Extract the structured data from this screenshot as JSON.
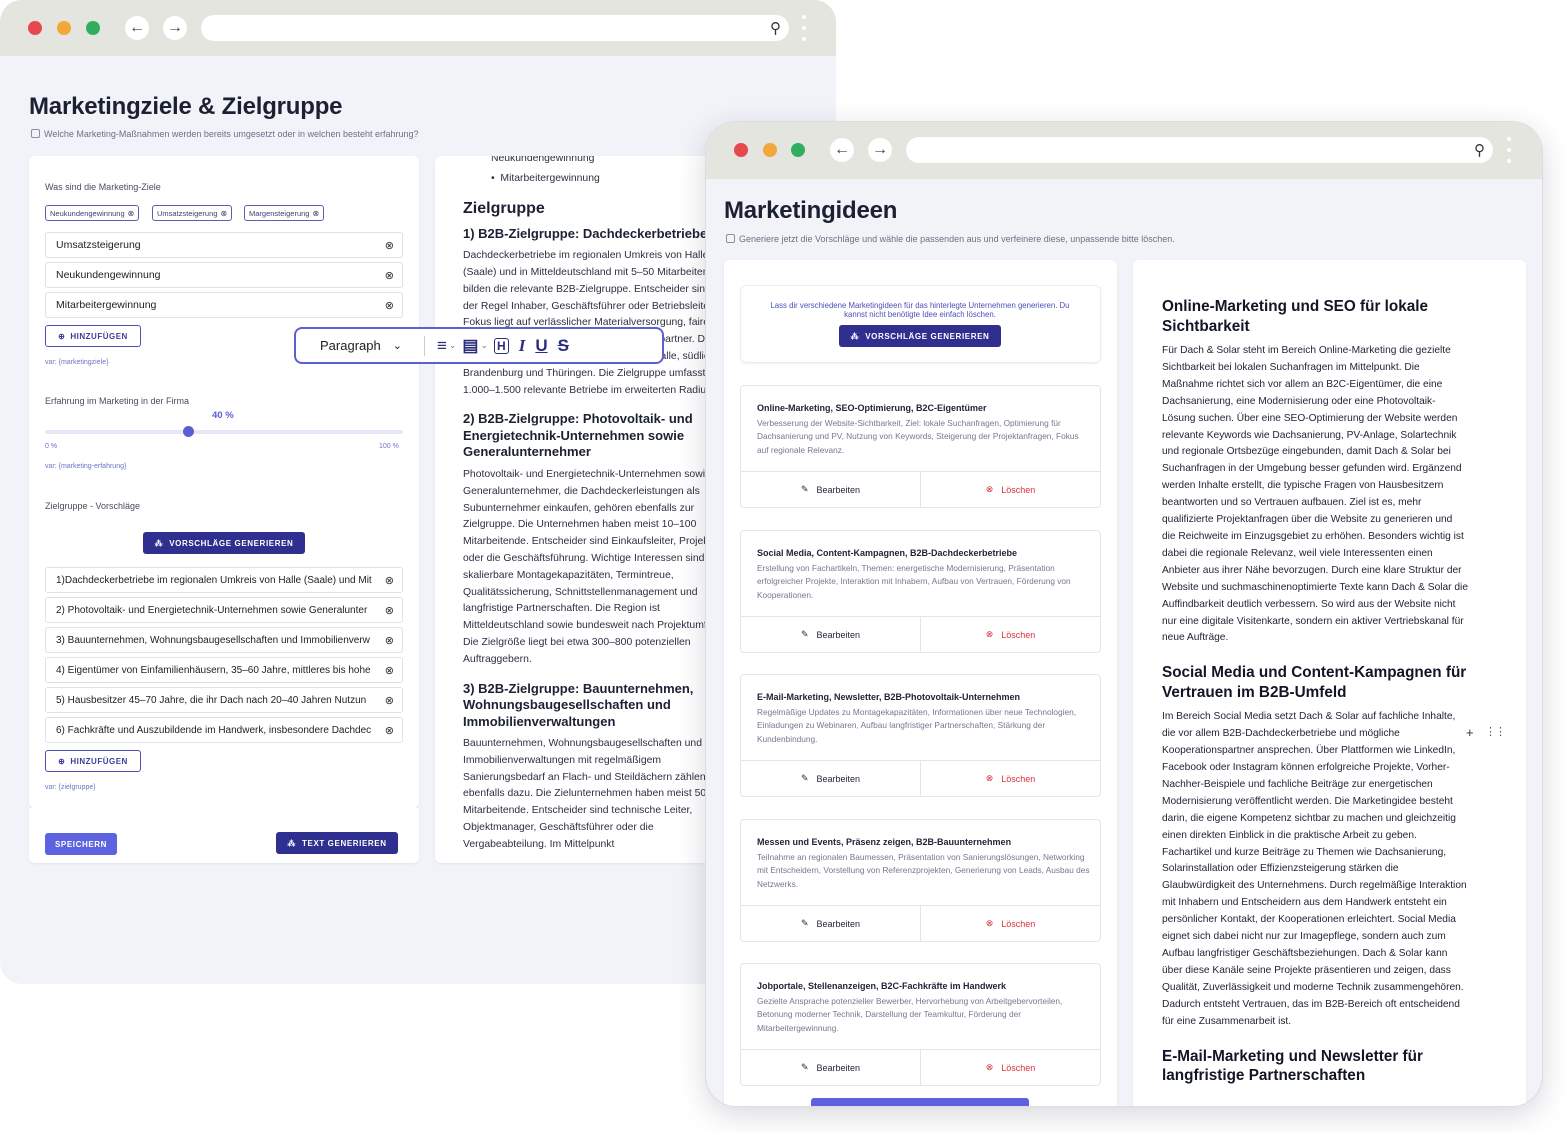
{
  "back_window": {
    "page_title": "Marketingziele & Zielgruppe",
    "hint": "Welche Marketing-Maßnahmen werden bereits umgesetzt oder in welchen besteht erfahrung?",
    "goals_label": "Was sind die Marketing-Ziele",
    "chips": [
      "Neukundengewinnung",
      "Umsatzsteigerung",
      "Margensteigerung"
    ],
    "goals": [
      "Umsatzsteigerung",
      "Neukundengewinnung",
      "Mitarbeitergewinnung"
    ],
    "add_label": "HINZUFÜGEN",
    "goals_var": "var: {marketingziele}",
    "experience_label": "Erfahrung im Marketing in der Firma",
    "experience_value": "40 %",
    "experience_fraction": 0.4,
    "slider_min": "0 %",
    "slider_max": "100 %",
    "experience_var": "var: {marketing-erfahrung}",
    "target_label": "Zielgruppe - Vorschläge",
    "generate_label": "VORSCHLÄGE GENERIEREN",
    "targets": [
      "1)Dachdeckerbetriebe im regionalen Umkreis von Halle (Saale) und Mit",
      "2) Photovoltaik- und Energietechnik-Unternehmen sowie Generalunter",
      "3) Bauunternehmen, Wohnungsbaugesellschaften und Immobilienverw",
      "4) Eigentümer von Einfamilienhäusern, 35–60 Jahre, mittleres bis hohe",
      "5) Hausbesitzer 45–70 Jahre, die ihr Dach nach 20–40 Jahren Nutzun",
      "6) Fachkräfte und Auszubildende im Handwerk, insbesondere Dachdec"
    ],
    "targets_var": "var: {zielgruppe}",
    "save_label": "SPEICHERN",
    "generate_text_label": "TEXT GENERIEREN",
    "toolbar": {
      "paragraph": "Paragraph"
    },
    "doc": {
      "list_cut": "Neukundengewinnung",
      "list_item": "Mitarbeitergewinnung",
      "section_title": "Zielgruppe",
      "h1": "1) B2B-Zielgruppe: Dachdeckerbetriebe",
      "p1": "Dachdeckerbetriebe im regionalen Umkreis von Halle (Saale) und in Mitteldeutschland mit 5–50 Mitarbeitenden bilden die relevante B2B-Zielgruppe. Entscheider sind in der Regel Inhaber, Geschäftsführer oder Betriebsleiter. Ihr Fokus liegt auf verlässlicher Materialversorgung, fairen Preisen und einem zuverlässigen Montagepartner. Die Region umfasst Sachsen-Anhalt, Leipzig/Halle, südliches Brandenburg und Thüringen. Die Zielgruppe umfasst etwa 1.000–1.500 relevante Betriebe im erweiterten Radius.",
      "h2": "2) B2B-Zielgruppe: Photovoltaik- und Energietechnik-Unternehmen sowie Generalunternehmer",
      "p2": "Photovoltaik- und Energietechnik-Unternehmen sowie Generalunternehmer, die Dachdeckerleistungen als Subunternehmer einkaufen, gehören ebenfalls zur Zielgruppe. Die Unternehmen haben meist 10–100 Mitarbeitende. Entscheider sind Einkaufsleiter, Projektleiter oder die Geschäftsführung. Wichtige Interessen sind skalierbare Montagekapazitäten, Termintreue, Qualitätssicherung, Schnittstellenmanagement und langfristige Partnerschaften. Die Region ist Mitteldeutschland sowie bundesweit nach Projektumfeld. Die Zielgröße liegt bei etwa 300–800 potenziellen Auftraggebern.",
      "h3": "3) B2B-Zielgruppe: Bauunternehmen, Wohnungsbaugesellschaften und Immobilienverwaltungen",
      "p3": "Bauunternehmen, Wohnungsbaugesellschaften und Immobilienverwaltungen mit regelmäßigem Sanierungsbedarf an Flach- und Steildächern zählen ebenfalls dazu. Die Zielunternehmen haben meist 50–500 Mitarbeitende. Entscheider sind technische Leiter, Objektmanager, Geschäftsführer oder die Vergabeabteilung. Im Mittelpunkt"
    }
  },
  "front_window": {
    "page_title": "Marketingideen",
    "hint": "Generiere jetzt die Vorschläge und wähle die passenden aus und verfeinere diese, unpassende bitte löschen.",
    "intro": "Lass dir verschiedene Marketingideen für das hinterlegte Unternehmen generieren. Du kannst nicht benötigte Idee einfach löschen.",
    "generate_label": "VORSCHLÄGE GENERIEREN",
    "edit_label": "Bearbeiten",
    "delete_label": "Löschen",
    "ideas": [
      {
        "title": "Online-Marketing, SEO-Optimierung, B2C-Eigentümer",
        "desc": "Verbesserung der Website-Sichtbarkeit, Ziel: lokale Suchanfragen, Optimierung für Dachsanierung und PV, Nutzung von Keywords, Steigerung der Projektanfragen, Fokus auf regionale Relevanz."
      },
      {
        "title": "Social Media, Content-Kampagnen, B2B-Dachdeckerbetriebe",
        "desc": "Erstellung von Fachartikeln, Themen: energetische Modernisierung, Präsentation erfolgreicher Projekte, Interaktion mit Inhabern, Aufbau von Vertrauen, Förderung von Kooperationen."
      },
      {
        "title": "E-Mail-Marketing, Newsletter, B2B-Photovoltaik-Unternehmen",
        "desc": "Regelmäßige Updates zu Montagekapazitäten, Informationen über neue Technologien, Einladungen zu Webinaren, Aufbau langfristiger Partnerschaften, Stärkung der Kundenbindung."
      },
      {
        "title": "Messen und Events, Präsenz zeigen, B2B-Bauunternehmen",
        "desc": "Teilnahme an regionalen Baumessen, Präsentation von Sanierungslösungen, Networking mit Entscheidern, Vorstellung von Referenzprojekten, Generierung von Leads, Ausbau des Netzwerks."
      },
      {
        "title": "Jobportale, Stellenanzeigen, B2C-Fachkräfte im Handwerk",
        "desc": "Gezielte Ansprache potenzieller Bewerber, Hervorhebung von Arbeitgebervorteilen, Betonung moderner Technik, Darstellung der Teamkultur, Förderung der Mitarbeitergewinnung."
      }
    ],
    "article": [
      {
        "title": "Online-Marketing und SEO für lokale Sichtbarkeit",
        "text": "Für Dach & Solar steht im Bereich Online-Marketing die gezielte Sichtbarkeit bei lokalen Suchanfragen im Mittelpunkt. Die Maßnahme richtet sich vor allem an B2C-Eigentümer, die eine Dachsanierung, eine Modernisierung oder eine Photovoltaik-Lösung suchen. Über eine SEO-Optimierung der Website werden relevante Keywords wie Dachsanierung, PV-Anlage, Solartechnik und regionale Ortsbezüge eingebunden, damit Dach & Solar bei Suchanfragen in der Umgebung besser gefunden wird. Ergänzend werden Inhalte erstellt, die typische Fragen von Hausbesitzern beantworten und so Vertrauen aufbauen. Ziel ist es, mehr qualifizierte Projektanfragen über die Website zu generieren und die Reichweite im Einzugsgebiet zu erhöhen. Besonders wichtig ist dabei die regionale Relevanz, weil viele Interessenten einen Anbieter aus ihrer Nähe bevorzugen. Durch eine klare Struktur der Website und suchmaschinenoptimierte Texte kann Dach & Solar die Auffindbarkeit deutlich verbessern. So wird aus der Website nicht nur eine digitale Visitenkarte, sondern ein aktiver Vertriebskanal für neue Aufträge."
      },
      {
        "title": "Social Media und Content-Kampagnen für Vertrauen im B2B-Umfeld",
        "text": "Im Bereich Social Media setzt Dach & Solar auf fachliche Inhalte, die vor allem B2B-Dachdeckerbetriebe und mögliche Kooperationspartner ansprechen. Über Plattformen wie LinkedIn, Facebook oder Instagram können erfolgreiche Projekte, Vorher-Nachher-Beispiele und fachliche Beiträge zur energetischen Modernisierung veröffentlicht werden. Die Marketingidee besteht darin, die eigene Kompetenz sichtbar zu machen und gleichzeitig einen direkten Einblick in die praktische Arbeit zu geben. Fachartikel und kurze Beiträge zu Themen wie Dachsanierung, Solarinstallation oder Effizienzsteigerung stärken die Glaubwürdigkeit des Unternehmens. Durch regelmäßige Interaktion mit Inhabern und Entscheidern aus dem Handwerk entsteht ein persönlicher Kontakt, der Kooperationen erleichtert. Social Media eignet sich dabei nicht nur zur Imagepflege, sondern auch zum Aufbau langfristiger Geschäftsbeziehungen. Dach & Solar kann über diese Kanäle seine Projekte präsentieren und zeigen, dass Qualität, Zuverlässigkeit und moderne Technik zusammengehören. Dadurch entsteht Vertrauen, das im B2B-Bereich oft entscheidend für eine Zusammenarbeit ist."
      },
      {
        "title": "E-Mail-Marketing und Newsletter für langfristige Partnerschaften",
        "text": ""
      }
    ]
  }
}
